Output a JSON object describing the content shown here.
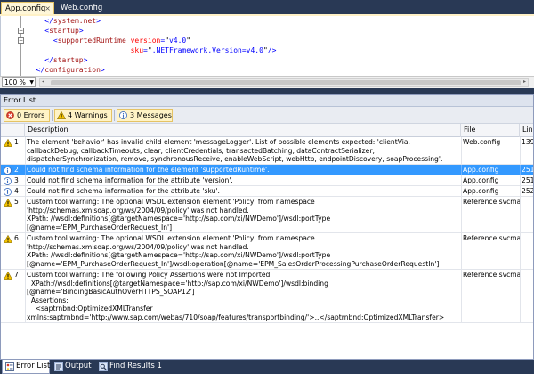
{
  "doc_tabs": [
    {
      "label": "App.config",
      "active": true
    },
    {
      "label": "Web.config",
      "active": false
    }
  ],
  "doc_tab_close": "×",
  "code_lines": [
    [
      {
        "cls": "c-b",
        "t": "    </"
      },
      {
        "cls": "c-t",
        "t": "system.net"
      },
      {
        "cls": "c-b",
        "t": ">"
      }
    ],
    [
      {
        "cls": "c-b",
        "t": "    <"
      },
      {
        "cls": "c-t",
        "t": "startup"
      },
      {
        "cls": "c-b",
        "t": ">"
      }
    ],
    [
      {
        "cls": "c-b",
        "t": "      <"
      },
      {
        "cls": "c-t",
        "t": "supportedRuntime"
      },
      {
        "cls": "c-k",
        "t": " "
      },
      {
        "cls": "c-a",
        "t": "version"
      },
      {
        "cls": "c-b",
        "t": "="
      },
      {
        "cls": "c-k",
        "t": "\""
      },
      {
        "cls": "c-v",
        "t": "v4.0"
      },
      {
        "cls": "c-k",
        "t": "\""
      }
    ],
    [
      {
        "cls": "c-k",
        "t": "                        "
      },
      {
        "cls": "c-a",
        "t": "sku"
      },
      {
        "cls": "c-b",
        "t": "="
      },
      {
        "cls": "c-k",
        "t": "\""
      },
      {
        "cls": "c-v",
        "t": ".NETFramework,Version=v4.0"
      },
      {
        "cls": "c-k",
        "t": "\""
      },
      {
        "cls": "c-b",
        "t": "/>"
      }
    ],
    [
      {
        "cls": "c-b",
        "t": "    </"
      },
      {
        "cls": "c-t",
        "t": "startup"
      },
      {
        "cls": "c-b",
        "t": ">"
      }
    ],
    [
      {
        "cls": "c-b",
        "t": "  </"
      },
      {
        "cls": "c-t",
        "t": "configuration"
      },
      {
        "cls": "c-b",
        "t": ">"
      }
    ]
  ],
  "fold_symbols": {
    "collapse": "−"
  },
  "editor_status": {
    "zoom": "100 %",
    "zoom_arrow": "▼",
    "scroll_left": "◂",
    "scroll_right": "▸"
  },
  "error_list": {
    "title": "Error List",
    "filters": {
      "errors": "0 Errors",
      "warnings": "4 Warnings",
      "messages": "3 Messages"
    },
    "columns": {
      "description": "Description",
      "file": "File",
      "line": "Line"
    },
    "rows": [
      {
        "type": "warning",
        "num": "1",
        "description": "The element 'behavior' has invalid child element 'messageLogger'. List of possible elements expected: 'clientVia, callbackDebug, callbackTimeouts, clear, clientCredentials, transactedBatching, dataContractSerializer, dispatcherSynchronization, remove, synchronousReceive, enableWebScript, webHttp, endpointDiscovery, soapProcessing'.",
        "file": "Web.config",
        "line": "139",
        "selected": false
      },
      {
        "type": "info",
        "num": "2",
        "description": "Could not find schema information for the element 'supportedRuntime'.",
        "file": "App.config",
        "line": "251",
        "selected": true
      },
      {
        "type": "info",
        "num": "3",
        "description": "Could not find schema information for the attribute 'version'.",
        "file": "App.config",
        "line": "251",
        "selected": false
      },
      {
        "type": "info",
        "num": "4",
        "description": "Could not find schema information for the attribute 'sku'.",
        "file": "App.config",
        "line": "252",
        "selected": false
      },
      {
        "type": "warning",
        "num": "5",
        "description": "Custom tool warning: The optional WSDL extension element 'Policy' from namespace\n'http://schemas.xmlsoap.org/ws/2004/09/policy' was not handled.\nXPath: //wsdl:definitions[@targetNamespace='http://sap.com/xi/NWDemo']/wsdl:portType\n[@name='EPM_PurchaseOrderRequest_In']",
        "file": "Reference.svcmap",
        "line": "",
        "selected": false
      },
      {
        "type": "warning",
        "num": "6",
        "description": "Custom tool warning: The optional WSDL extension element 'Policy' from namespace\n'http://schemas.xmlsoap.org/ws/2004/09/policy' was not handled.\nXPath: //wsdl:definitions[@targetNamespace='http://sap.com/xi/NWDemo']/wsdl:portType\n[@name='EPM_PurchaseOrderRequest_In']/wsdl:operation[@name='EPM_SalesOrderProcessingPurchaseOrderRequestIn']",
        "file": "Reference.svcmap",
        "line": "",
        "selected": false
      },
      {
        "type": "warning",
        "num": "7",
        "description": "Custom tool warning: The following Policy Assertions were not Imported:\n  XPath://wsdl:definitions[@targetNamespace='http://sap.com/xi/NWDemo']/wsdl:binding\n[@name='BindingBasicAuthOverHTTPS_SOAP12']\n  Assertions:\n    <saptrnbnd:OptimizedXMLTransfer\nxmlns:saptrnbnd='http://www.sap.com/webas/710/soap/features/transportbinding/'>..</saptrnbnd:OptimizedXMLTransfer>",
        "file": "Reference.svcmap",
        "line": "",
        "selected": false
      }
    ]
  },
  "bottom_tabs": [
    {
      "label": "Error List",
      "icon": "error-list-icon",
      "active": true
    },
    {
      "label": "Output",
      "icon": "output-icon",
      "active": false
    },
    {
      "label": "Find Results 1",
      "icon": "find-results-icon",
      "active": false
    }
  ],
  "colors": {
    "selection": "#3399ff",
    "warning": "#f5c400",
    "info": "#3b6dbf",
    "error": "#d83a2a",
    "chrome": "#293955"
  }
}
